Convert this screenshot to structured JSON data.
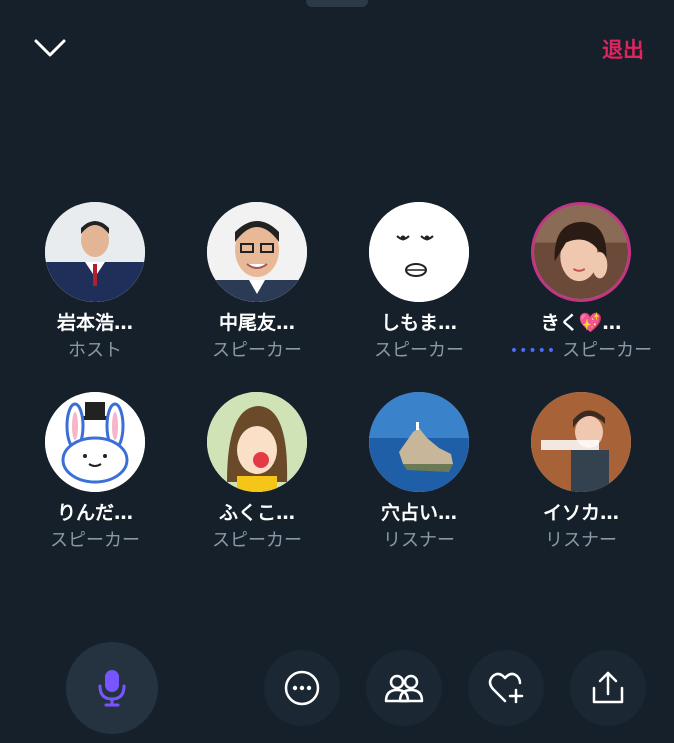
{
  "header": {
    "leave_label": "退出",
    "collapse_icon": "chevron-down-icon"
  },
  "participants": [
    {
      "name": "岩本浩…",
      "role": "ホスト"
    },
    {
      "name": "中尾友…",
      "role": "スピーカー"
    },
    {
      "name": "しもま…",
      "role": "スピーカー"
    },
    {
      "name": "きく💖…",
      "role": "スピーカー",
      "speaking": true
    },
    {
      "name": "りんだ…",
      "role": "スピーカー"
    },
    {
      "name": "ふくこ…",
      "role": "スピーカー"
    },
    {
      "name": "穴占い…",
      "role": "リスナー"
    },
    {
      "name": "イソカ…",
      "role": "リスナー"
    }
  ],
  "controls": {
    "mic_icon": "microphone-icon",
    "more_icon": "more-icon",
    "people_icon": "people-icon",
    "like_icon": "heart-plus-icon",
    "share_icon": "share-icon"
  },
  "colors": {
    "background": "#15202b",
    "leave": "#e0245e",
    "mic": "#7856ff",
    "secondary_text": "#8b98a5"
  }
}
